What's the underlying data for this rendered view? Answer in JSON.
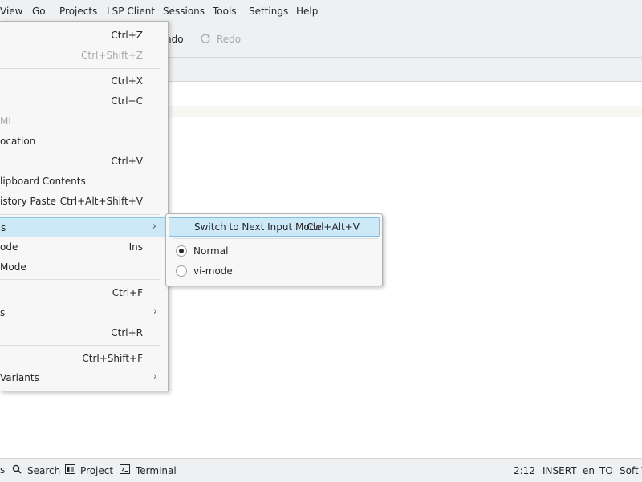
{
  "menubar": {
    "items": [
      "View",
      "Go",
      "Projects",
      "LSP Client",
      "Sessions",
      "Tools",
      "Settings",
      "Help"
    ]
  },
  "toolbar": {
    "undo_label": "ndo",
    "redo_label": "Redo",
    "redo_icon": "redo-icon"
  },
  "edit_menu": {
    "items": [
      {
        "label": "",
        "shortcut": "Ctrl+Z",
        "enabled": true
      },
      {
        "label": "",
        "shortcut": "Ctrl+Shift+Z",
        "enabled": false
      },
      {
        "label": "",
        "shortcut": "Ctrl+X",
        "enabled": true
      },
      {
        "label": "",
        "shortcut": "Ctrl+C",
        "enabled": true
      },
      {
        "label": "ML",
        "shortcut": "",
        "enabled": false
      },
      {
        "label": "ocation",
        "shortcut": "",
        "enabled": true
      },
      {
        "label": "",
        "shortcut": "Ctrl+V",
        "enabled": true
      },
      {
        "label": "lipboard Contents",
        "shortcut": "",
        "enabled": true
      },
      {
        "label": "istory Paste",
        "shortcut": "Ctrl+Alt+Shift+V",
        "enabled": true
      },
      {
        "label": "s",
        "shortcut": "",
        "enabled": true,
        "submenu": true,
        "highlighted": true
      },
      {
        "label": "ode",
        "shortcut": "Ins",
        "enabled": true
      },
      {
        "label": "Mode",
        "shortcut": "",
        "enabled": true
      },
      {
        "label": "",
        "shortcut": "Ctrl+F",
        "enabled": true
      },
      {
        "label": "s",
        "shortcut": "",
        "enabled": true,
        "submenu": true
      },
      {
        "label": "",
        "shortcut": "Ctrl+R",
        "enabled": true
      },
      {
        "label": "",
        "shortcut": "Ctrl+Shift+F",
        "enabled": true
      },
      {
        "label": "Variants",
        "shortcut": "",
        "enabled": true,
        "submenu": true
      }
    ]
  },
  "input_modes_submenu": {
    "switch_label": "Switch to Next Input Mode",
    "switch_shortcut": "Ctrl+Alt+V",
    "modes": [
      {
        "label": "Normal",
        "selected": true
      },
      {
        "label": "vi-mode",
        "selected": false
      }
    ]
  },
  "statusbar": {
    "search_label": "Search",
    "project_label": "Project",
    "terminal_label": "Terminal",
    "position": "2:12",
    "mode": "INSERT",
    "language": "en_TO",
    "wrap": "Soft T"
  },
  "colors": {
    "highlight": "#cde8f7",
    "highlight_border": "#8fc6e8",
    "chrome_bg": "#eff0f1"
  }
}
